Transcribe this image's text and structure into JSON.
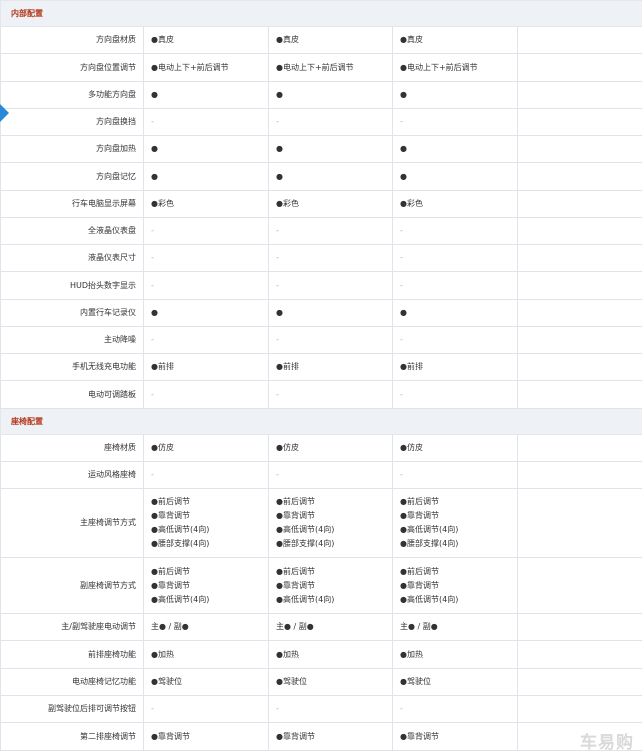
{
  "sections": [
    {
      "title": "内部配置",
      "rows": [
        {
          "label": "方向盘材质",
          "h": 27,
          "cells": [
            "●真皮",
            "●真皮",
            "●真皮",
            ""
          ]
        },
        {
          "label": "方向盘位置调节",
          "h": 28,
          "cells": [
            "●电动上下+前后调节",
            "●电动上下+前后调节",
            "●电动上下+前后调节",
            ""
          ]
        },
        {
          "label": "多功能方向盘",
          "h": 27,
          "cells": [
            "●",
            "●",
            "●",
            ""
          ]
        },
        {
          "label": "方向盘换挡",
          "h": 27,
          "cells": [
            "-",
            "-",
            "-",
            ""
          ]
        },
        {
          "label": "方向盘加热",
          "h": 27,
          "cells": [
            "●",
            "●",
            "●",
            ""
          ]
        },
        {
          "label": "方向盘记忆",
          "h": 28,
          "cells": [
            "●",
            "●",
            "●",
            ""
          ]
        },
        {
          "label": "行车电脑显示屏幕",
          "h": 27,
          "cells": [
            "●彩色",
            "●彩色",
            "●彩色",
            ""
          ]
        },
        {
          "label": "全液晶仪表盘",
          "h": 27,
          "cells": [
            "-",
            "-",
            "-",
            ""
          ]
        },
        {
          "label": "液晶仪表尺寸",
          "h": 27,
          "cells": [
            "-",
            "-",
            "-",
            ""
          ]
        },
        {
          "label": "HUD抬头数字显示",
          "h": 28,
          "cells": [
            "-",
            "-",
            "-",
            ""
          ]
        },
        {
          "label": "内置行车记录仪",
          "h": 27,
          "cells": [
            "●",
            "●",
            "●",
            ""
          ]
        },
        {
          "label": "主动降噪",
          "h": 27,
          "cells": [
            "-",
            "-",
            "-",
            ""
          ]
        },
        {
          "label": "手机无线充电功能",
          "h": 27,
          "cells": [
            "●前排",
            "●前排",
            "●前排",
            ""
          ]
        },
        {
          "label": "电动可调踏板",
          "h": 28,
          "cells": [
            "-",
            "-",
            "-",
            ""
          ]
        }
      ]
    },
    {
      "title": "座椅配置",
      "rows": [
        {
          "label": "座椅材质",
          "h": 27,
          "cells": [
            "●仿皮",
            "●仿皮",
            "●仿皮",
            ""
          ]
        },
        {
          "label": "运动风格座椅",
          "h": 27,
          "cells": [
            "-",
            "-",
            "-",
            ""
          ]
        },
        {
          "label": "主座椅调节方式",
          "h": 69,
          "cells": [
            [
              "●前后调节",
              "●靠背调节",
              "●高低调节(4向)",
              "●腰部支撑(4向)"
            ],
            [
              "●前后调节",
              "●靠背调节",
              "●高低调节(4向)",
              "●腰部支撑(4向)"
            ],
            [
              "●前后调节",
              "●靠背调节",
              "●高低调节(4向)",
              "●腰部支撑(4向)"
            ],
            ""
          ]
        },
        {
          "label": "副座椅调节方式",
          "h": 56,
          "cells": [
            [
              "●前后调节",
              "●靠背调节",
              "●高低调节(4向)"
            ],
            [
              "●前后调节",
              "●靠背调节",
              "●高低调节(4向)"
            ],
            [
              "●前后调节",
              "●靠背调节",
              "●高低调节(4向)"
            ],
            ""
          ]
        },
        {
          "label": "主/副驾驶座电动调节",
          "h": 27,
          "cells": [
            "主● / 副●",
            "主● / 副●",
            "主● / 副●",
            ""
          ]
        },
        {
          "label": "前排座椅功能",
          "h": 28,
          "cells": [
            "●加热",
            "●加热",
            "●加热",
            ""
          ]
        },
        {
          "label": "电动座椅记忆功能",
          "h": 27,
          "cells": [
            "●驾驶位",
            "●驾驶位",
            "●驾驶位",
            ""
          ]
        },
        {
          "label": "副驾驶位后排可调节按钮",
          "h": 27,
          "cells": [
            "-",
            "-",
            "-",
            ""
          ]
        },
        {
          "label": "第二排座椅调节",
          "h": 28,
          "cells": [
            "●靠背调节",
            "●靠背调节",
            "●靠背调节",
            ""
          ]
        }
      ]
    }
  ],
  "watermark": "车易购"
}
